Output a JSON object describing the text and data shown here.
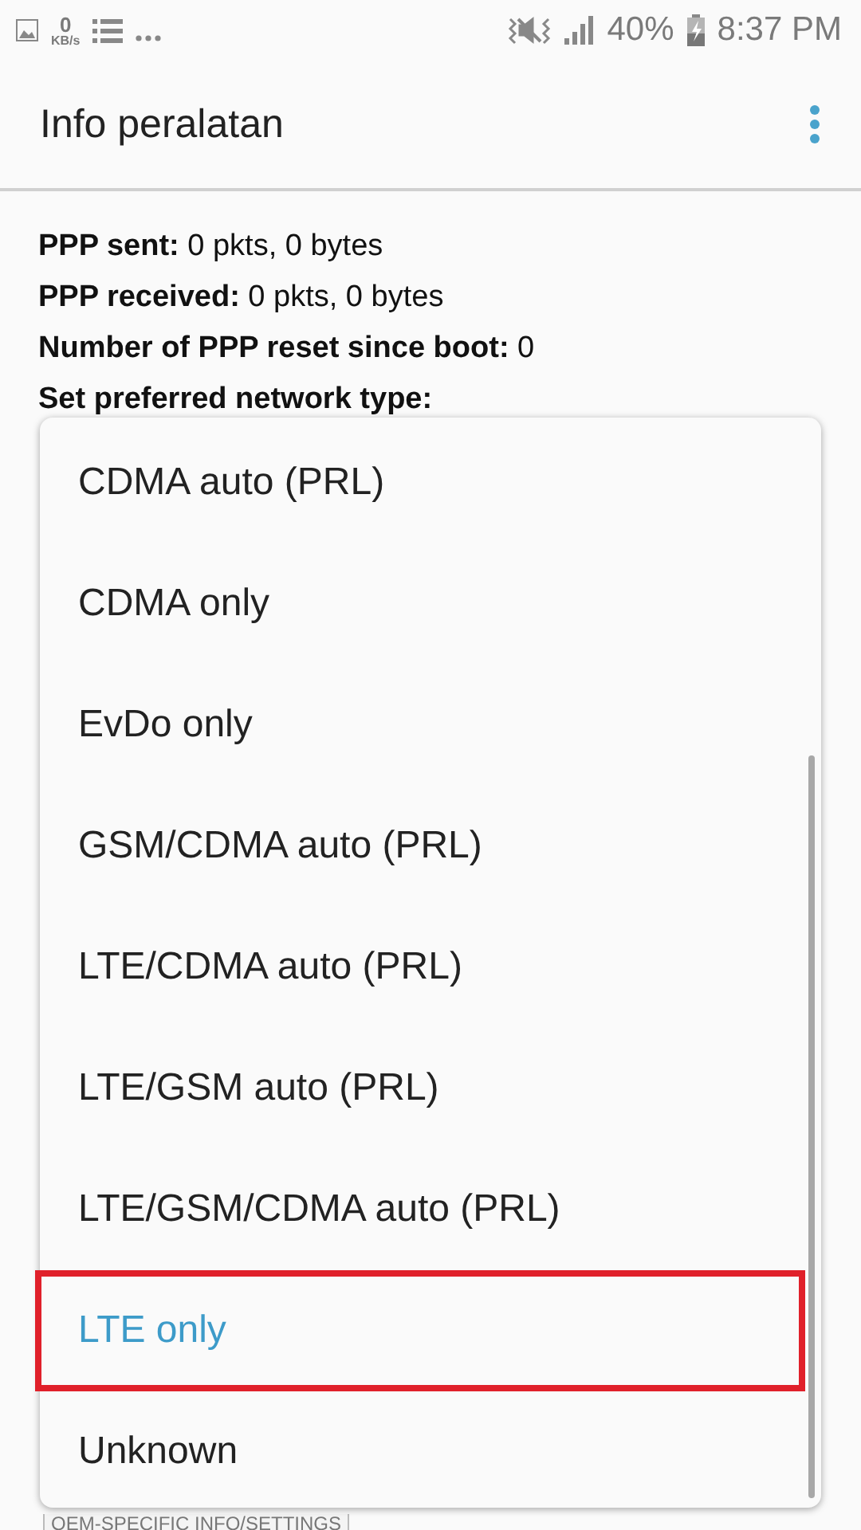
{
  "status_bar": {
    "speed_value": "0",
    "speed_unit": "KB/s",
    "battery": "40%",
    "time": "8:37 PM"
  },
  "app_bar": {
    "title": "Info peralatan"
  },
  "info_lines": [
    {
      "label": "PPP sent:",
      "value": " 0 pkts, 0 bytes"
    },
    {
      "label": "PPP received:",
      "value": " 0 pkts, 0 bytes"
    },
    {
      "label": "Number of PPP reset since boot:",
      "value": " 0"
    },
    {
      "label": "Set preferred network type:"
    }
  ],
  "dropdown": {
    "options": [
      {
        "label": "CDMA auto (PRL)",
        "selected": false
      },
      {
        "label": "CDMA only",
        "selected": false
      },
      {
        "label": "EvDo only",
        "selected": false
      },
      {
        "label": "GSM/CDMA auto (PRL)",
        "selected": false
      },
      {
        "label": "LTE/CDMA auto (PRL)",
        "selected": false
      },
      {
        "label": "LTE/GSM auto (PRL)",
        "selected": false
      },
      {
        "label": "LTE/GSM/CDMA auto (PRL)",
        "selected": false
      },
      {
        "label": "LTE only",
        "selected": true
      },
      {
        "label": "Unknown",
        "selected": false
      }
    ]
  },
  "oem_button": {
    "label": "OEM-SPECIFIC INFO/SETTINGS"
  }
}
